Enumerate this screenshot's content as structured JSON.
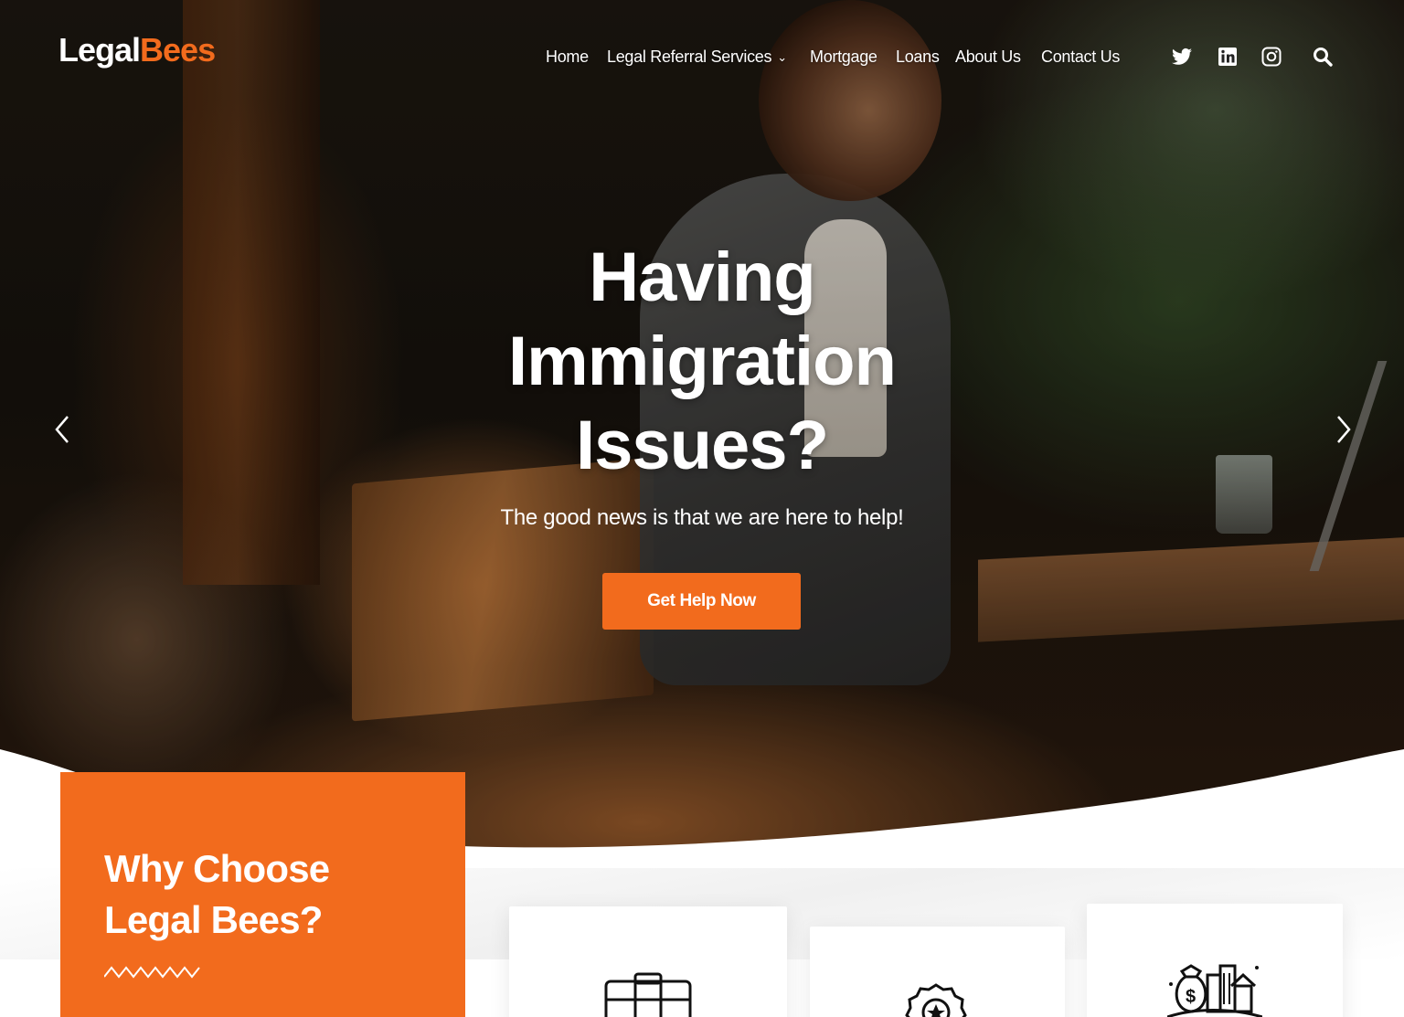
{
  "brand": {
    "logo_main": "Legal",
    "logo_accent": "Bees",
    "accent_color": "#f26b1d"
  },
  "nav": {
    "items": [
      {
        "label": "Home"
      },
      {
        "label": "Legal Referral Services",
        "has_dropdown": true
      },
      {
        "label": "Mortgage"
      },
      {
        "label": "Loans"
      },
      {
        "label": "About Us"
      },
      {
        "label": "Contact Us"
      }
    ],
    "social_icons": [
      "twitter-icon",
      "linkedin-icon",
      "instagram-icon"
    ],
    "search_icon": "search-icon"
  },
  "hero": {
    "headline_line1": "Having",
    "headline_line2": "Immigration",
    "headline_line3": "Issues?",
    "subheadline": "The good news is that we are here to help!",
    "cta_label": "Get Help Now",
    "prev_icon": "chevron-left-icon",
    "next_icon": "chevron-right-icon"
  },
  "why": {
    "title_line1": "Why Choose",
    "title_line2": "Legal Bees?"
  },
  "features": {
    "icons": [
      "briefcase-icon",
      "badge-star-icon",
      "money-bag-city-icon"
    ]
  }
}
